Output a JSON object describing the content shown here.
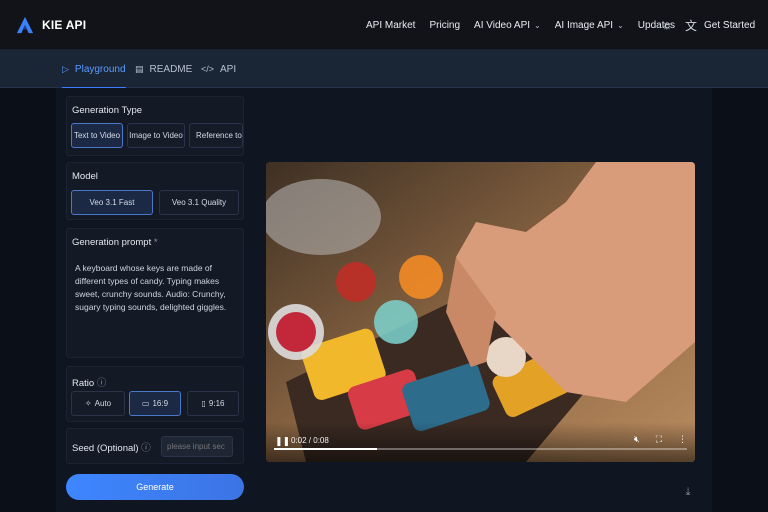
{
  "brand": {
    "name": "KIE API"
  },
  "nav": {
    "items": [
      {
        "label": "API Market",
        "dropdown": false
      },
      {
        "label": "Pricing",
        "dropdown": false
      },
      {
        "label": "AI Video API",
        "dropdown": true
      },
      {
        "label": "AI Image API",
        "dropdown": true
      },
      {
        "label": "Updates",
        "dropdown": false
      }
    ],
    "icons": [
      "sun-icon",
      "translate-icon"
    ],
    "cta": "Get Started"
  },
  "tabs": [
    {
      "label": "Playground",
      "icon": "play-icon",
      "active": true
    },
    {
      "label": "README",
      "icon": "document-icon",
      "active": false
    },
    {
      "label": "API",
      "icon": "code-icon",
      "active": false
    }
  ],
  "form": {
    "generation_type": {
      "title": "Generation Type",
      "options": [
        "Text to Video",
        "Image to Video",
        "Reference to Vi"
      ],
      "selected": "Text to Video"
    },
    "model": {
      "title": "Model",
      "options": [
        "Veo 3.1 Fast",
        "Veo 3.1 Quality"
      ],
      "selected": "Veo 3.1 Fast"
    },
    "prompt": {
      "title": "Generation prompt",
      "required_mark": "*",
      "value": "A keyboard whose keys are made of different types of candy. Typing makes sweet, crunchy sounds. Audio: Crunchy, sugary typing sounds, delighted giggles."
    },
    "ratio": {
      "title": "Ratio",
      "options": [
        {
          "label": "Auto",
          "icon": "magic-wand-icon"
        },
        {
          "label": "16:9",
          "icon": "landscape-icon"
        },
        {
          "label": "9:16",
          "icon": "portrait-icon"
        }
      ],
      "selected": "16:9"
    },
    "seed": {
      "title": "Seed (Optional)",
      "placeholder": "please input sec"
    },
    "generate_label": "Generate"
  },
  "video": {
    "time": "0:02 / 0:08",
    "progress": 0.25
  },
  "colors": {
    "accent": "#3d7bff",
    "background": "#0b0f17",
    "panel": "#131a26"
  }
}
